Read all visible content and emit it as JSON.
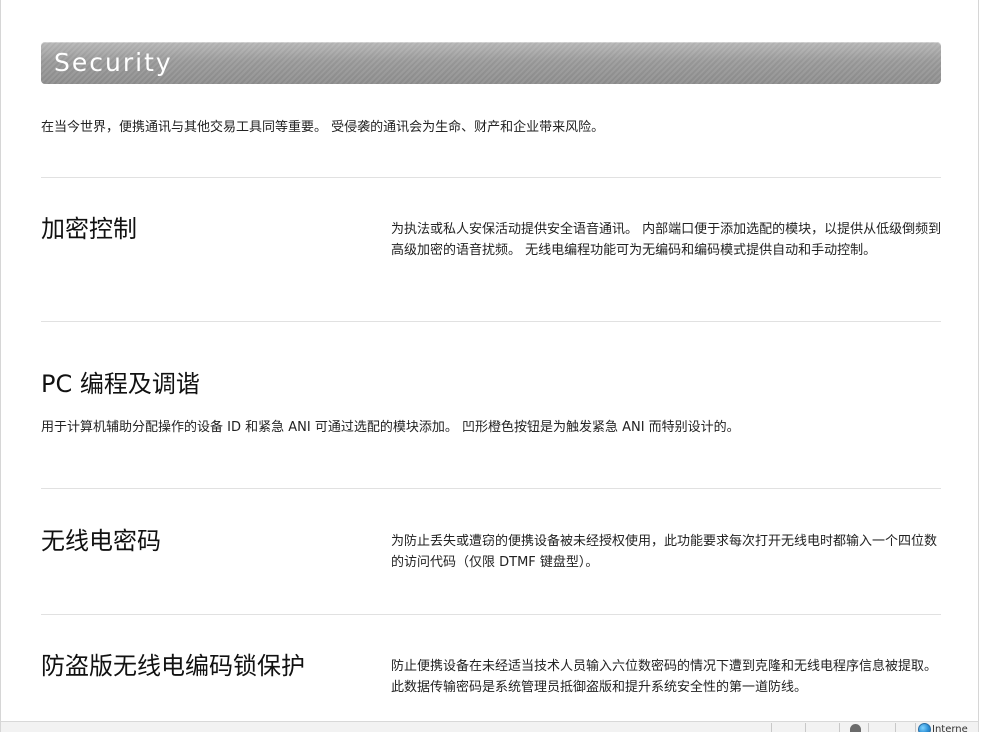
{
  "header": {
    "title": "Security"
  },
  "intro": {
    "text": "在当今世界，便携通讯与其他交易工具同等重要。 受侵袭的通讯会为生命、财产和企业带来风险。"
  },
  "sections": [
    {
      "title": "加密控制",
      "text": "为执法或私人安保活动提供安全语音通讯。 内部端口便于添加选配的模块，以提供从低级倒频到高级加密的语音扰频。 无线电编程功能可为无编码和编码模式提供自动和手动控制。"
    },
    {
      "title": "PC 编程及调谐",
      "text": "用于计算机辅助分配操作的设备 ID 和紧急 ANI 可通过选配的模块添加。 凹形橙色按钮是为触发紧急 ANI 而特别设计的。"
    },
    {
      "title": "无线电密码",
      "text": "为防止丢失或遭窃的便携设备被未经授权使用，此功能要求每次打开无线电时都输入一个四位数的访问代码（仅限 DTMF 键盘型）。"
    },
    {
      "title": "防盗版无线电编码锁保护",
      "text": "防止便携设备在未经适当技术人员输入六位数密码的情况下遭到克隆和无线电程序信息被提取。 此数据传输密码是系统管理员抵御盗版和提升系统安全性的第一道防线。"
    }
  ],
  "status_bar": {
    "zone_text": "Interne"
  }
}
